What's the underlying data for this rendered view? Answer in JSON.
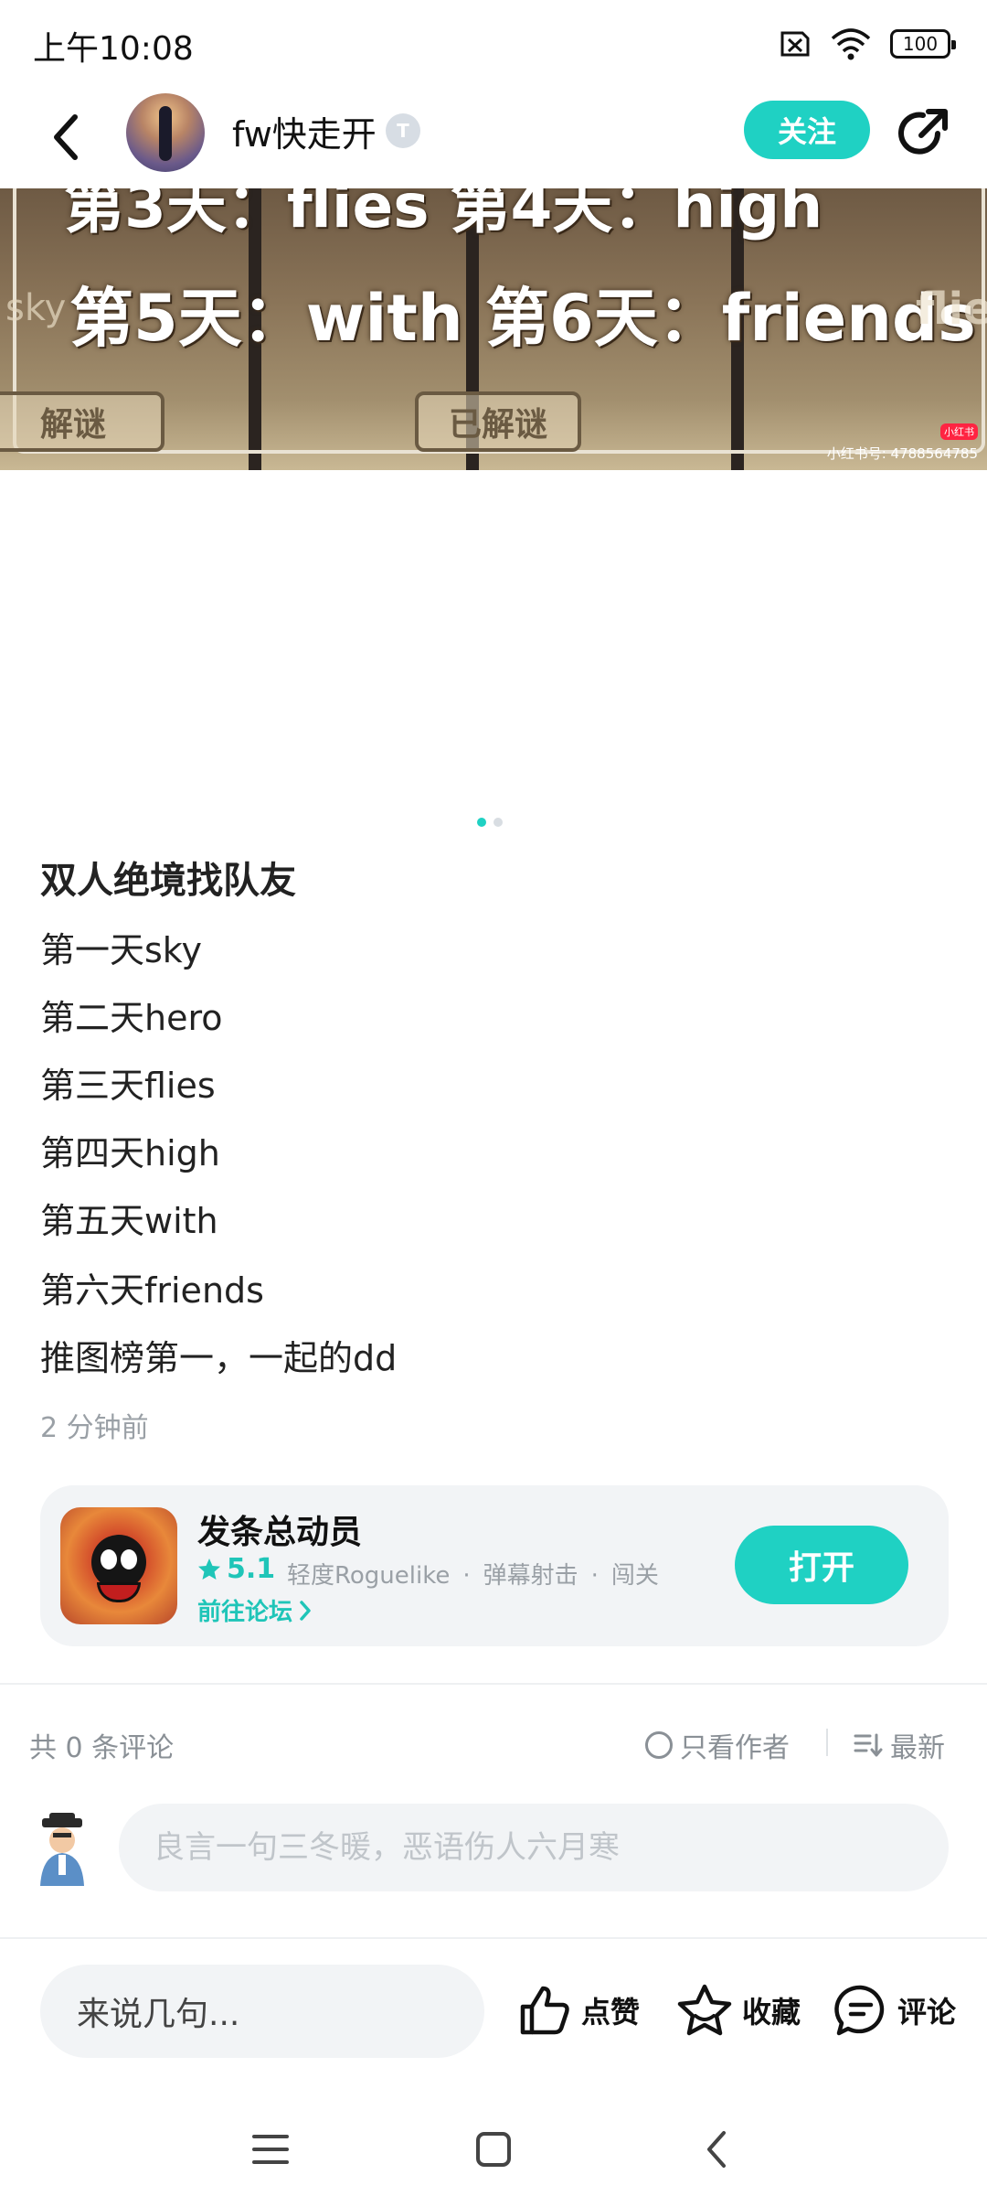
{
  "status_bar": {
    "time": "上午10:08",
    "battery": "100"
  },
  "header": {
    "username": "fw快走开",
    "level_badge": "T",
    "follow_label": "关注"
  },
  "image": {
    "line_top": "第3天：flies  第4天：high",
    "line_main": "第5天：with  第6天：friends",
    "side_left": "sky",
    "side_right": "flie",
    "stamp_left": "解谜",
    "stamp_center": "已解谜",
    "watermark_logo": "小红书",
    "watermark_id": "小红书号: 4788564785"
  },
  "post": {
    "title": "双人绝境找队友",
    "lines": [
      "第一天sky",
      "第二天hero",
      "第三天flies",
      "第四天high",
      "第五天with",
      "第六天friends",
      "推图榜第一，一起的dd"
    ],
    "time_ago": "2 分钟前"
  },
  "game_card": {
    "name": "发条总动员",
    "rating": "5.1",
    "tags": [
      "轻度Roguelike",
      "弹幕射击",
      "闯关"
    ],
    "forum_link": "前往论坛",
    "open_label": "打开"
  },
  "comments": {
    "count_text": "共 0 条评论",
    "author_only": "只看作者",
    "sort": "最新",
    "input_placeholder": "良言一句三冬暖，恶语伤人六月寒"
  },
  "bottom_bar": {
    "quick_input": "来说几句...",
    "like": "点赞",
    "favorite": "收藏",
    "comment": "评论"
  },
  "colors": {
    "accent": "#1fd1c3",
    "muted_text": "#9aa0a6",
    "card_bg": "#f2f4f6"
  }
}
